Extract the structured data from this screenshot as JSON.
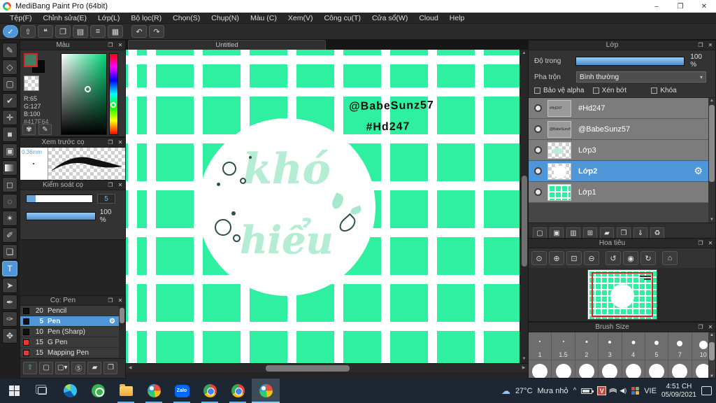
{
  "window": {
    "title": "MediBang Paint Pro (64bit)",
    "minimize": "–",
    "restore": "❐",
    "close": "✕"
  },
  "icons": {
    "popup": "❐",
    "close": "✕",
    "gear": "⚙",
    "dropdown": "▾",
    "up": "▲",
    "down": "▼",
    "left": "◀",
    "right": "▶",
    "undo": "↶",
    "redo": "↷",
    "cloud": "☁"
  },
  "menu": {
    "items": [
      "Tệp(F)",
      "Chỉnh sửa(E)",
      "Lớp(L)",
      "Bộ lọc(R)",
      "Chọn(S)",
      "Chụp(N)",
      "Màu (C)",
      "Xem(V)",
      "Công cụ(T)",
      "Cửa sổ(W)",
      "Cloud",
      "Help"
    ]
  },
  "quickbar": {
    "glyphs": [
      "✓",
      "⇧",
      "❝",
      "❐",
      "▤",
      "≡",
      "▦"
    ]
  },
  "tools": {
    "glyphs": [
      "✎",
      "◇",
      "▢",
      "✔",
      "✛",
      "■",
      "▣",
      "",
      "◻",
      "◌",
      "✶",
      "✐",
      "❏",
      "T",
      "➤",
      "✒",
      "✑",
      "✥"
    ]
  },
  "color_panel": {
    "title": "Màu",
    "r": "R:65",
    "g": "G:127",
    "b": "B:100",
    "hex": "#417F64",
    "footer_glyphs": [
      "✾",
      "✎"
    ]
  },
  "preview_panel": {
    "title": "Xem trước cọ",
    "size": "0.36mm"
  },
  "control_panel": {
    "title": "Kiểm soát cọ",
    "value": "5",
    "percent": "100 %"
  },
  "brush_panel": {
    "title": "Cọ: Pen",
    "footer_glyphs": [
      "⇧",
      "▢",
      "▢▾",
      "Ⓢ",
      "▰",
      "❐"
    ],
    "brushes": [
      {
        "size": "20",
        "name": "Pencil"
      },
      {
        "size": "5",
        "name": "Pen"
      },
      {
        "size": "10",
        "name": "Pen (Sharp)"
      },
      {
        "size": "15",
        "name": "G Pen"
      },
      {
        "size": "15",
        "name": "Mapping Pen"
      }
    ]
  },
  "canvas": {
    "tab": "Untitled",
    "credit_handle": "@BabeSunz57",
    "credit_tag": "#Hd247",
    "word_top": "khó",
    "word_bottom": "hiểu"
  },
  "layers_panel": {
    "title": "Lớp",
    "opacity_label": "Độ trong",
    "opacity_value": "100 %",
    "blend_label": "Pha trộn",
    "blend_value": "Bình thường",
    "check_alpha": "Bảo vệ alpha",
    "check_clip": "Xén bớt",
    "check_lock": "Khóa",
    "footer_glyphs": [
      "▢",
      "▣",
      "▥",
      "⊞",
      "▰",
      "❐",
      "⇓",
      "♻"
    ],
    "layers": [
      {
        "name": "#Hd247"
      },
      {
        "name": "@BabeSunz57"
      },
      {
        "name": "Lớp3"
      },
      {
        "name": "Lớp2"
      },
      {
        "name": "Lớp1"
      }
    ]
  },
  "navigator_panel": {
    "title": "Hoa tiêu",
    "toolbar_glyphs": [
      "⊙",
      "⊕",
      "⊡",
      "⊖",
      "↺",
      "◉",
      "↻",
      "⌂"
    ]
  },
  "brush_size_panel": {
    "title": "Brush Size",
    "sizes": [
      "1",
      "1.5",
      "2",
      "3",
      "4",
      "5",
      "7",
      "10"
    ]
  },
  "taskbar": {
    "weather_temp": "27°C",
    "weather_desc": "Mưa nhỏ",
    "tray_expand": "^",
    "lang": "VIE",
    "time": "4:51 CH",
    "date": "05/09/2021",
    "zalo_label": "Zalo",
    "vbox_label": "V"
  },
  "colors": {
    "canvas_green": "#2EF0A0",
    "accent_blue": "#4E96D8",
    "foreground_swatch": "#417F64",
    "brush_swatch_red": "#E23B3B"
  }
}
